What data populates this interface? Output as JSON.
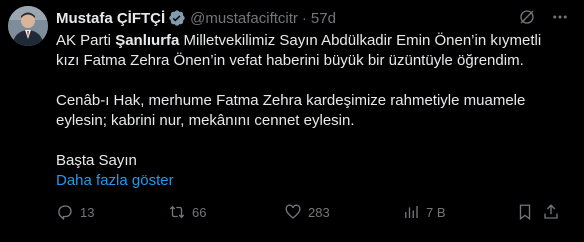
{
  "author": {
    "name": "Mustafa ÇİFTÇİ",
    "handle": "@mustafaciftcitr",
    "time": "57d",
    "separator": "·"
  },
  "tweet": {
    "line1_pre": "AK Parti ",
    "line1_bold": "Şanlıurfa",
    "line1_post": " Milletvekilimiz Sayın Abdülkadir Emin Önen’in kıymetli",
    "line2": "kızı Fatma Zehra Önen’in vefat haberini büyük bir üzüntüyle öğrendim.",
    "line3": "Cenâb-ı Hak, merhume Fatma Zehra kardeşimize rahmetiyle muamele",
    "line4": "eylesin; kabrini nur, mekânını cennet eylesin.",
    "line5": "Başta Sayın",
    "show_more": "Daha fazla göster"
  },
  "actions": {
    "replies": "13",
    "reposts": "66",
    "likes": "283",
    "views": "7 B"
  },
  "colors": {
    "background": "#000000",
    "text": "#e7e9ea",
    "muted": "#71767b",
    "link": "#1d9bf0",
    "verified": "#829aab"
  },
  "icons": [
    "verified-badge-icon",
    "grok-icon",
    "more-icon",
    "reply-icon",
    "repost-icon",
    "like-icon",
    "views-icon",
    "bookmark-icon",
    "share-icon"
  ]
}
